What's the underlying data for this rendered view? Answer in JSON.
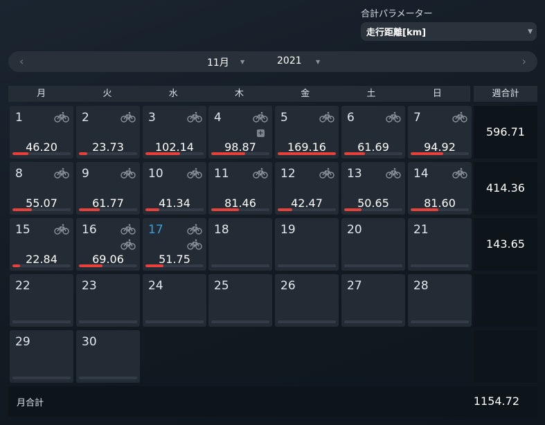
{
  "parameter": {
    "label": "合計パラメーター",
    "selected": "走行距離[km]"
  },
  "nav": {
    "prev_icon": "chevron-left-icon",
    "next_icon": "chevron-right-icon",
    "month": "11月",
    "year": "2021"
  },
  "weekdays": [
    "月",
    "火",
    "水",
    "木",
    "金",
    "土",
    "日"
  ],
  "week_total_header": "週合計",
  "accent_color": "#e8403a",
  "today_color": "#3aa0e0",
  "days": [
    {
      "day": "1",
      "value": "46.20",
      "bikes": 1,
      "progress": 0.27
    },
    {
      "day": "2",
      "value": "23.73",
      "bikes": 1,
      "progress": 0.14
    },
    {
      "day": "3",
      "value": "102.14",
      "bikes": 1,
      "progress": 0.6
    },
    {
      "day": "4",
      "value": "98.87",
      "bikes": 1,
      "progress": 0.58,
      "plus": true
    },
    {
      "day": "5",
      "value": "169.16",
      "bikes": 1,
      "progress": 1.0
    },
    {
      "day": "6",
      "value": "61.69",
      "bikes": 1,
      "progress": 0.36
    },
    {
      "day": "7",
      "value": "94.92",
      "bikes": 1,
      "progress": 0.56
    },
    {
      "day": "8",
      "value": "55.07",
      "bikes": 1,
      "progress": 0.33
    },
    {
      "day": "9",
      "value": "61.77",
      "bikes": 1,
      "progress": 0.36
    },
    {
      "day": "10",
      "value": "41.34",
      "bikes": 1,
      "progress": 0.24
    },
    {
      "day": "11",
      "value": "81.46",
      "bikes": 1,
      "progress": 0.48
    },
    {
      "day": "12",
      "value": "42.47",
      "bikes": 1,
      "progress": 0.25
    },
    {
      "day": "13",
      "value": "50.65",
      "bikes": 1,
      "progress": 0.3
    },
    {
      "day": "14",
      "value": "81.60",
      "bikes": 1,
      "progress": 0.48
    },
    {
      "day": "15",
      "value": "22.84",
      "bikes": 1,
      "progress": 0.13
    },
    {
      "day": "16",
      "value": "69.06",
      "bikes": 2,
      "progress": 0.41
    },
    {
      "day": "17",
      "value": "51.75",
      "bikes": 2,
      "progress": 0.31,
      "today": true
    },
    {
      "day": "18",
      "value": "",
      "bikes": 0,
      "progress": 0
    },
    {
      "day": "19",
      "value": "",
      "bikes": 0,
      "progress": 0
    },
    {
      "day": "20",
      "value": "",
      "bikes": 0,
      "progress": 0
    },
    {
      "day": "21",
      "value": "",
      "bikes": 0,
      "progress": 0
    },
    {
      "day": "22",
      "value": "",
      "bikes": 0,
      "progress": 0
    },
    {
      "day": "23",
      "value": "",
      "bikes": 0,
      "progress": 0
    },
    {
      "day": "24",
      "value": "",
      "bikes": 0,
      "progress": 0
    },
    {
      "day": "25",
      "value": "",
      "bikes": 0,
      "progress": 0
    },
    {
      "day": "26",
      "value": "",
      "bikes": 0,
      "progress": 0
    },
    {
      "day": "27",
      "value": "",
      "bikes": 0,
      "progress": 0
    },
    {
      "day": "28",
      "value": "",
      "bikes": 0,
      "progress": 0
    },
    {
      "day": "29",
      "value": "",
      "bikes": 0,
      "progress": 0
    },
    {
      "day": "30",
      "value": "",
      "bikes": 0,
      "progress": 0
    }
  ],
  "week_totals": [
    "596.71",
    "414.36",
    "143.65",
    "",
    ""
  ],
  "month_total": {
    "label": "月合計",
    "value": "1154.72"
  }
}
